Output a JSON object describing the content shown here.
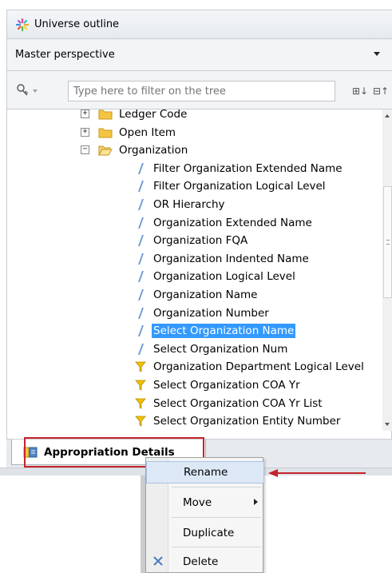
{
  "panel": {
    "title": "Universe outline",
    "perspective": "Master perspective",
    "filter_placeholder": "Type here to filter on the tree",
    "expand_all_label": "⊞↓",
    "collapse_all_label": "⊟↑"
  },
  "tree": {
    "items": [
      {
        "label": "Ledger Code",
        "kind": "folder",
        "expander": "+"
      },
      {
        "label": "Open Item",
        "kind": "folder",
        "expander": "+"
      },
      {
        "label": "Organization",
        "kind": "folder-open",
        "expander": "−"
      },
      {
        "label": "Filter Organization Extended Name",
        "kind": "dimension"
      },
      {
        "label": "Filter Organization Logical Level",
        "kind": "dimension"
      },
      {
        "label": "OR Hierarchy",
        "kind": "dimension"
      },
      {
        "label": "Organization Extended Name",
        "kind": "dimension"
      },
      {
        "label": "Organization FQA",
        "kind": "dimension"
      },
      {
        "label": "Organization Indented Name",
        "kind": "dimension"
      },
      {
        "label": "Organization Logical Level",
        "kind": "dimension"
      },
      {
        "label": "Organization Name",
        "kind": "dimension"
      },
      {
        "label": "Organization Number",
        "kind": "dimension"
      },
      {
        "label": "Select Organization Name",
        "kind": "dimension",
        "selected": true
      },
      {
        "label": "Select Organization Num",
        "kind": "dimension"
      },
      {
        "label": "Organization Department Logical Level",
        "kind": "filter"
      },
      {
        "label": "Select Organization COA Yr",
        "kind": "filter"
      },
      {
        "label": "Select Organization COA Yr List",
        "kind": "filter"
      },
      {
        "label": "Select Organization Entity Number",
        "kind": "filter"
      }
    ]
  },
  "tabs": {
    "active_label": "Appropriation Details"
  },
  "context_menu": {
    "items": [
      {
        "label": "Rename",
        "highlighted": true
      },
      {
        "label": "Move",
        "submenu": true
      },
      {
        "label": "Duplicate"
      },
      {
        "label": "Delete",
        "icon": "delete-x-icon"
      }
    ]
  },
  "colors": {
    "selection": "#3399ff",
    "callout": "#c3242a",
    "folder": "#f5c542",
    "dimension": "#6b9bd8",
    "filter": "#f2c200"
  }
}
